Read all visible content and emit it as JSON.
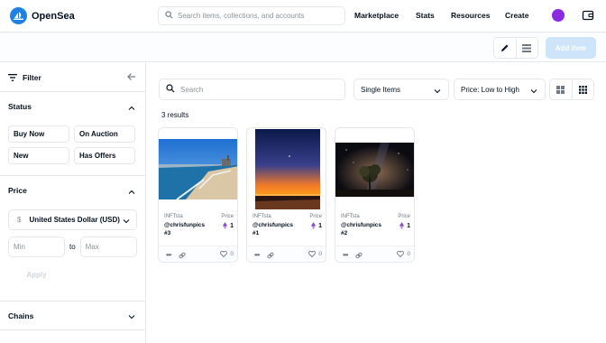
{
  "brand": {
    "name": "OpenSea"
  },
  "search": {
    "placeholder": "Search items, collections, and accounts"
  },
  "nav": {
    "marketplace": "Marketplace",
    "stats": "Stats",
    "resources": "Resources",
    "create": "Create"
  },
  "toolbar": {
    "add_item": "Add item"
  },
  "sidebar": {
    "filter_title": "Filter",
    "status": {
      "title": "Status",
      "options": [
        "Buy Now",
        "On Auction",
        "New",
        "Has Offers"
      ]
    },
    "price": {
      "title": "Price",
      "currency_symbol": "$",
      "currency": "United States Dollar (USD)",
      "min_placeholder": "Min",
      "to": "to",
      "max_placeholder": "Max",
      "apply": "Apply"
    },
    "chains": {
      "title": "Chains"
    }
  },
  "main": {
    "search_placeholder": "Search",
    "item_filter": "Single Items",
    "sort": "Price: Low to High",
    "results": "3 results"
  },
  "cards": [
    {
      "collection": "INFTsta",
      "price_label": "Price",
      "owner": "@chrisfunpics",
      "number": "#3",
      "price": "1",
      "likes": "0",
      "image": "beach-scene"
    },
    {
      "collection": "INFTsta",
      "price_label": "Price",
      "owner": "@chrisfunpics",
      "number": "#1",
      "price": "1",
      "likes": "0",
      "image": "sunset-scene"
    },
    {
      "collection": "INFTsta",
      "price_label": "Price",
      "owner": "@chrisfunpics",
      "number": "#2",
      "price": "1",
      "likes": "0",
      "image": "night-sky-tree"
    }
  ],
  "colors": {
    "accent": "#2081e2",
    "add_item_disabled": "#cde4fa",
    "avatar": "#8a2be2",
    "border": "#e5e8eb",
    "eth": "#8a56c5"
  }
}
